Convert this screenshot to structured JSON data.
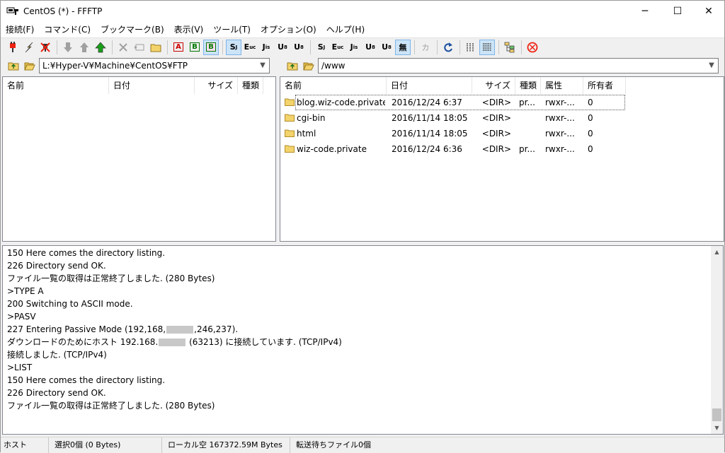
{
  "window": {
    "title": "CentOS (*) - FFFTP",
    "minimize": "─",
    "maximize": "☐",
    "close": "✕"
  },
  "menu": [
    "接続(F)",
    "コマンド(C)",
    "ブックマーク(B)",
    "表示(V)",
    "ツール(T)",
    "オプション(O)",
    "ヘルプ(H)"
  ],
  "toolbar": {
    "sjis": "S",
    "euc": "E",
    "jis": "J",
    "utf8": "U",
    "utf8n": "U",
    "sjis2": "S",
    "euc2": "E",
    "jis2": "J",
    "utf82": "U",
    "utf8n2": "U",
    "none": "無",
    "kana": "カ",
    "ascii": "A",
    "binary": "B",
    "auto": "B"
  },
  "local": {
    "path": "L:¥Hyper-V¥Machine¥CentOS¥FTP",
    "columns": [
      "名前",
      "日付",
      "サイズ",
      "種類"
    ]
  },
  "remote": {
    "path": "/www",
    "columns": [
      "名前",
      "日付",
      "サイズ",
      "種類",
      "属性",
      "所有者"
    ],
    "rows": [
      {
        "name": "blog.wiz-code.private",
        "date": "2016/12/24  6:37",
        "size": "<DIR>",
        "type": "pr...",
        "attr": "rwxr-...",
        "owner": "0"
      },
      {
        "name": "cgi-bin",
        "date": "2016/11/14 18:05",
        "size": "<DIR>",
        "type": "",
        "attr": "rwxr-...",
        "owner": "0"
      },
      {
        "name": "html",
        "date": "2016/11/14 18:05",
        "size": "<DIR>",
        "type": "",
        "attr": "rwxr-...",
        "owner": "0"
      },
      {
        "name": "wiz-code.private",
        "date": "2016/12/24  6:36",
        "size": "<DIR>",
        "type": "pr...",
        "attr": "rwxr-...",
        "owner": "0"
      }
    ]
  },
  "log": {
    "l1": "150 Here comes the directory listing.",
    "l2": "226 Directory send OK.",
    "l3": "ファイル一覧の取得は正常終了しました. (280 Bytes)",
    "l4": ">TYPE A",
    "l5": "200 Switching to ASCII mode.",
    "l6": ">PASV",
    "l7a": "227 Entering Passive Mode (192,168,",
    "l7b": ",246,237).",
    "l8a": "ダウンロードのためにホスト 192.168.",
    "l8b": " (63213) に接続しています. (TCP/IPv4)",
    "l9": "接続しました. (TCP/IPv4)",
    "l10": ">LIST",
    "l11": "150 Here comes the directory listing.",
    "l12": "226 Directory send OK.",
    "l13": "ファイル一覧の取得は正常終了しました. (280 Bytes)"
  },
  "status": {
    "host": "ホスト",
    "selection": "選択0個  (0 Bytes)",
    "local_free": "ローカル空 167372.59M Bytes",
    "queue": "転送待ちファイル0個"
  }
}
